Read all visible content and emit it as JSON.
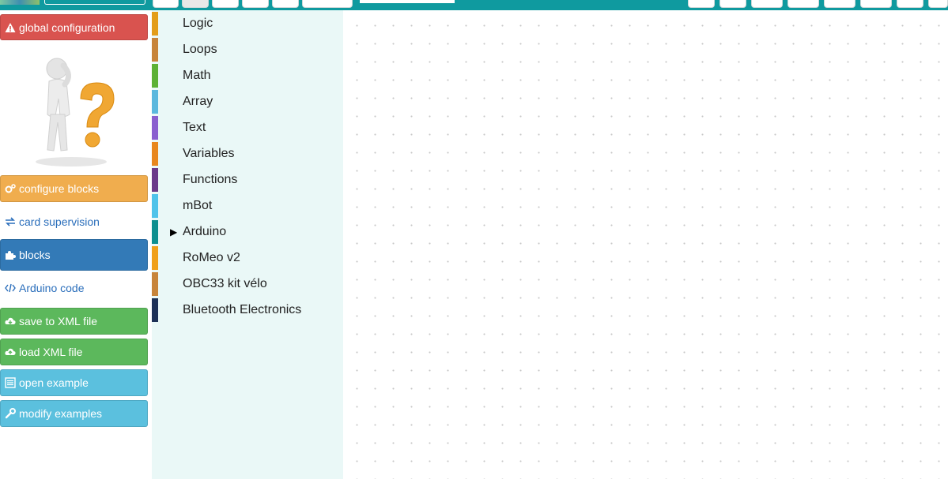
{
  "sidebar": {
    "global_configuration": "global configuration",
    "configure_blocks": "configure blocks",
    "card_supervision": "card supervision",
    "blocks": "blocks",
    "arduino_code": "Arduino code",
    "save_xml": "save to XML file",
    "load_xml": "load XML file",
    "open_example": "open example",
    "modify_examples": "modify examples"
  },
  "toolbox": {
    "categories": [
      {
        "label": "Logic",
        "color": "#e39d1a"
      },
      {
        "label": "Loops",
        "color": "#c7843a"
      },
      {
        "label": "Math",
        "color": "#5cb135"
      },
      {
        "label": "Array",
        "color": "#5bb8de"
      },
      {
        "label": "Text",
        "color": "#8a5fcf"
      },
      {
        "label": "Variables",
        "color": "#e8871e"
      },
      {
        "label": "Functions",
        "color": "#6b3a8a"
      },
      {
        "label": "mBot",
        "color": "#4fc3ea"
      },
      {
        "label": "Arduino",
        "color": "#0e8f8f",
        "expandable": true
      },
      {
        "label": "RoMeo v2",
        "color": "#f0a01a"
      },
      {
        "label": "OBC33 kit vélo",
        "color": "#c7843a"
      },
      {
        "label": "Bluetooth Electronics",
        "color": "#1d3157"
      }
    ]
  },
  "colors": {
    "topbar": "#0f9a9f",
    "toolbox_bg": "#eaf8f7"
  }
}
